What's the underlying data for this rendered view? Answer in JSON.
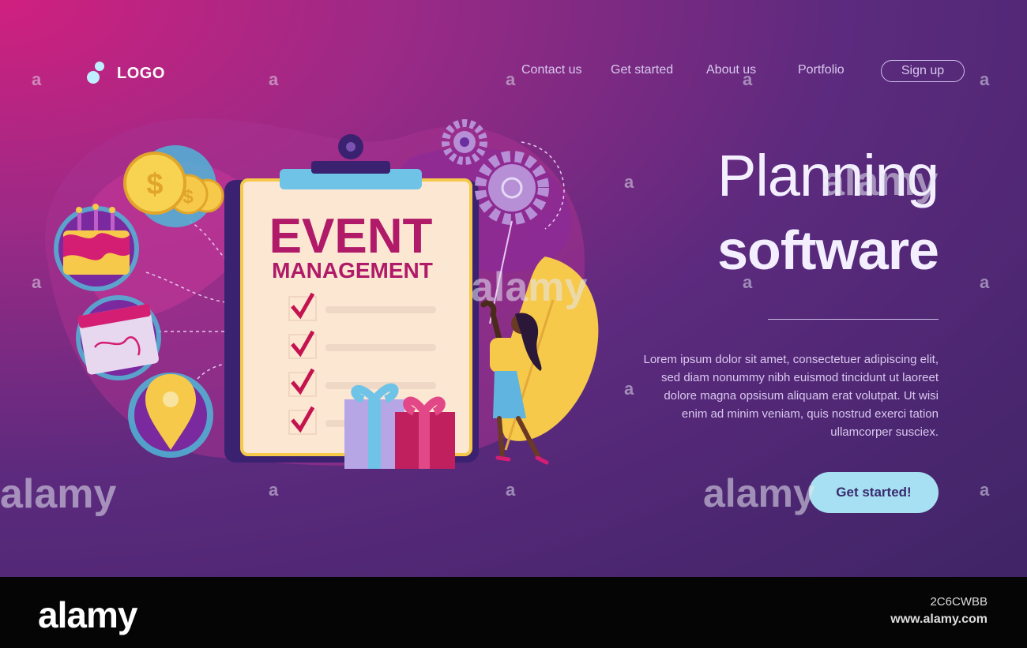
{
  "logo": {
    "text": "LOGO"
  },
  "nav": {
    "links": [
      "Contact us",
      "Get started",
      "About us",
      "Portfolio"
    ],
    "signup": "Sign up"
  },
  "hero": {
    "title_line1": "Planning",
    "title_line2": "software",
    "description": "Lorem ipsum dolor sit amet, consectetuer adipiscing elit, sed diam nonummy nibh euismod tincidunt ut laoreet dolore magna opsisum aliquam erat volutpat. Ut wisi enim ad minim veniam, quis nostrud exerci tation ullamcorper susciex.",
    "cta": "Get started!"
  },
  "illustration": {
    "clipboard_title": "EVENT",
    "clipboard_subtitle": "MANAGEMENT",
    "icons": [
      "coins-icon",
      "cake-icon",
      "calendar-icon",
      "location-pin-icon",
      "gears-icon",
      "gift-icon",
      "checkmark-icon"
    ]
  },
  "watermark": {
    "text": "alamy",
    "small": "a"
  },
  "footer": {
    "brand": "alamy",
    "image_id": "2C6CWBB",
    "url": "www.alamy.com"
  },
  "colors": {
    "accent_cta": "#a6e0f2",
    "checkmark": "#c4134f",
    "clipboard_title": "#b01a68"
  }
}
